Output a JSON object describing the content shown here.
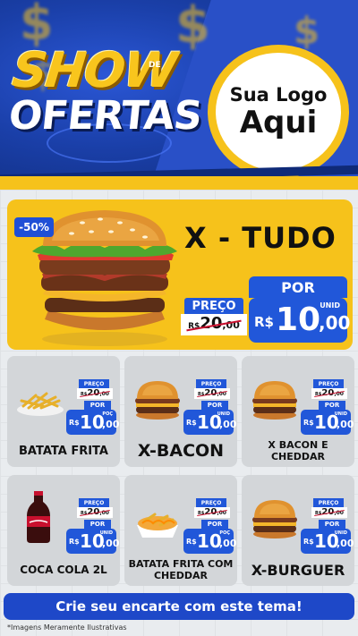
{
  "header": {
    "title_line1": "SHOW",
    "title_de": "DE",
    "title_line2": "OFERTAS",
    "logo_line1": "Sua Logo",
    "logo_line2": "Aqui",
    "currency_symbol": "$"
  },
  "hero": {
    "discount_badge": "-50%",
    "name": "X - TUDO",
    "por_label": "POR",
    "preco_label": "PREÇO",
    "old_currency": "R$",
    "old_value": "20",
    "old_cents": ",00",
    "unid_label": "UNID",
    "new_currency": "R$",
    "new_value": "10",
    "new_cents": ",00"
  },
  "products": [
    {
      "name": "BATATA FRITA",
      "preco_label": "PREÇO",
      "old_currency": "R$",
      "old_value": "20",
      "old_cents": ",00",
      "por_label": "POR",
      "unit_label": "POÇ",
      "new_currency": "R$",
      "new_value": "10",
      "new_cents": ",00",
      "image": "fries"
    },
    {
      "name": "X-BACON",
      "preco_label": "PREÇO",
      "old_currency": "R$",
      "old_value": "20",
      "old_cents": ",00",
      "por_label": "POR",
      "unit_label": "UNID",
      "new_currency": "R$",
      "new_value": "10",
      "new_cents": ",00",
      "image": "burger"
    },
    {
      "name": "X BACON E CHEDDAR",
      "preco_label": "PREÇO",
      "old_currency": "R$",
      "old_value": "20",
      "old_cents": ",00",
      "por_label": "POR",
      "unit_label": "UNID",
      "new_currency": "R$",
      "new_value": "10",
      "new_cents": ",00",
      "image": "burger"
    },
    {
      "name": "COCA COLA 2L",
      "preco_label": "PREÇO",
      "old_currency": "R$",
      "old_value": "20",
      "old_cents": ",00",
      "por_label": "POR",
      "unit_label": "UNID",
      "new_currency": "R$",
      "new_value": "10",
      "new_cents": ",00",
      "image": "soda"
    },
    {
      "name": "BATATA FRITA COM CHEDDAR",
      "preco_label": "PREÇO",
      "old_currency": "R$",
      "old_value": "20",
      "old_cents": ",00",
      "por_label": "POR",
      "unit_label": "POÇ",
      "new_currency": "R$",
      "new_value": "10",
      "new_cents": ",00",
      "image": "cheddar-fries"
    },
    {
      "name": "X-BURGUER",
      "preco_label": "PREÇO",
      "old_currency": "R$",
      "old_value": "20",
      "old_cents": ",00",
      "por_label": "POR",
      "unit_label": "UNID",
      "new_currency": "R$",
      "new_value": "10",
      "new_cents": ",00",
      "image": "burger"
    }
  ],
  "footer": {
    "cta": "Crie seu encarte com este tema!",
    "disclaimer": "*Imagens Meramente Ilustrativas"
  },
  "colors": {
    "brand_blue": "#2157d9",
    "brand_yellow": "#f6c21b",
    "header_blue": "#1a3fa8",
    "strike_red": "#c8102e"
  }
}
